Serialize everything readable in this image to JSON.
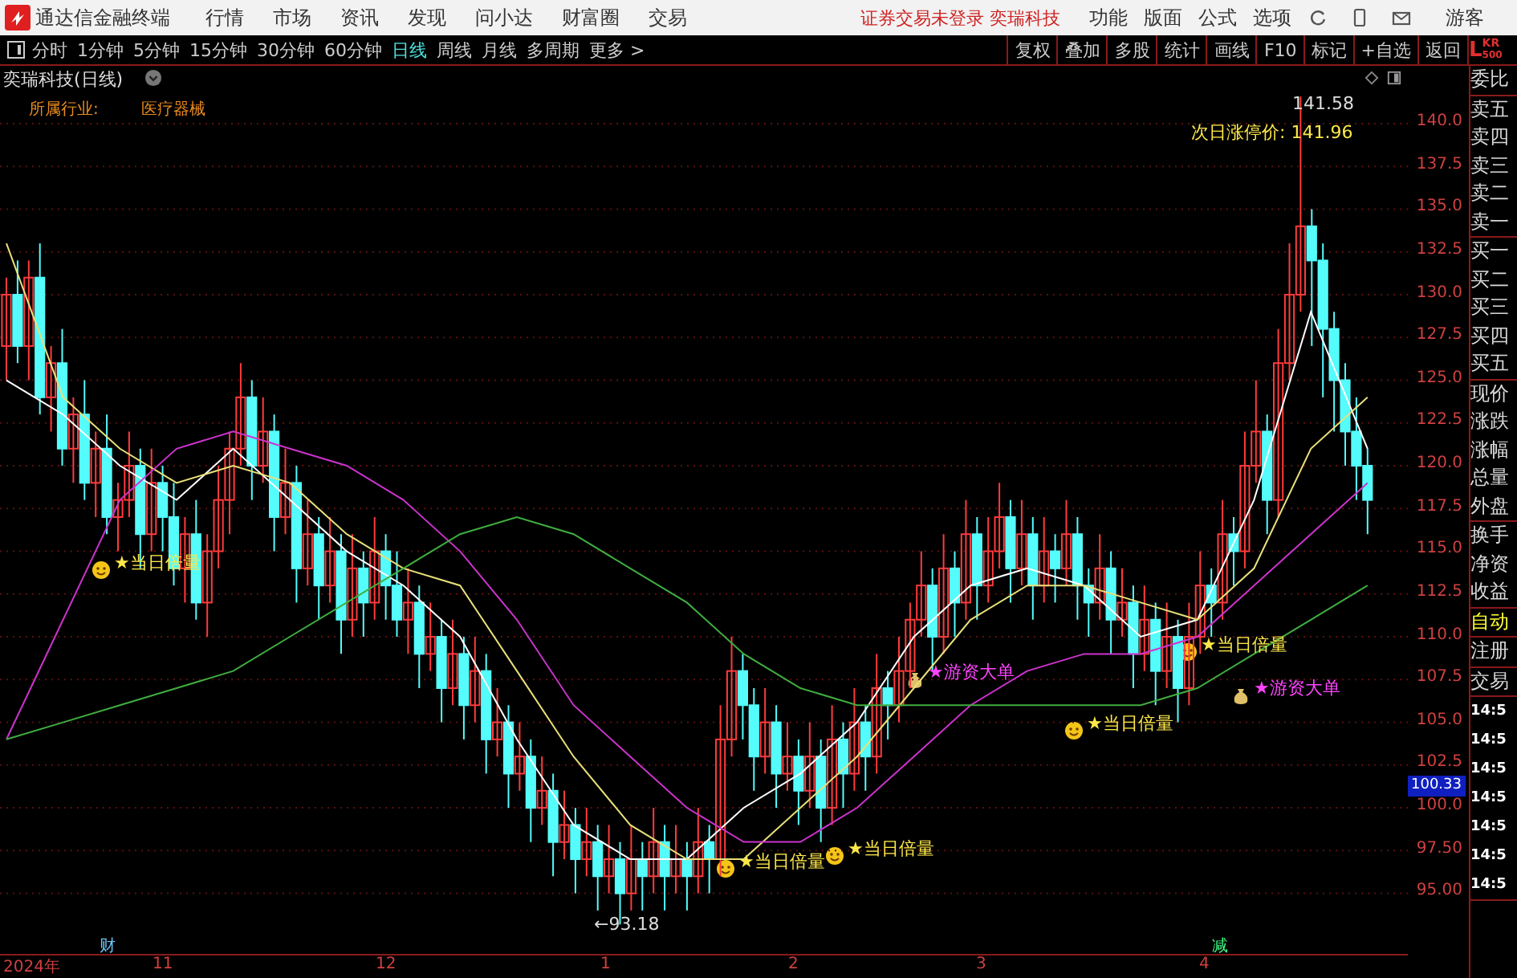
{
  "menu_bar": {
    "app_title": "通达信金融终端",
    "items": [
      "行情",
      "市场",
      "资讯",
      "发现",
      "问小达",
      "财富圈",
      "交易"
    ],
    "status": "证券交易未登录 奕瑞科技",
    "right_items": [
      "功能",
      "版面",
      "公式",
      "选项"
    ],
    "user": "游客"
  },
  "toolbar": {
    "periods": [
      {
        "label": "分时",
        "selected": false
      },
      {
        "label": "1分钟",
        "selected": false
      },
      {
        "label": "5分钟",
        "selected": false
      },
      {
        "label": "15分钟",
        "selected": false
      },
      {
        "label": "30分钟",
        "selected": false
      },
      {
        "label": "60分钟",
        "selected": false
      },
      {
        "label": "日线",
        "selected": true
      },
      {
        "label": "周线",
        "selected": false
      },
      {
        "label": "月线",
        "selected": false
      },
      {
        "label": "多周期",
        "selected": false
      },
      {
        "label": "更多 >",
        "selected": false
      }
    ],
    "buttons": [
      "复权",
      "叠加",
      "多股",
      "统计",
      "画线",
      "F10",
      "标记",
      "+自选",
      "返回"
    ]
  },
  "chart": {
    "title": "奕瑞科技(日线)",
    "industry_label": "所属行业:",
    "industry": "医疗器械",
    "annotations": [
      {
        "kind": "high",
        "text": "141.58"
      },
      {
        "kind": "limit",
        "text": "次日涨停价: 141.96"
      },
      {
        "kind": "signal",
        "text": "★当日倍量"
      },
      {
        "kind": "signal",
        "text": "★当日倍量"
      },
      {
        "kind": "signal",
        "text": "★当日倍量"
      },
      {
        "kind": "fund",
        "text": "★游资大单"
      },
      {
        "kind": "fund",
        "text": "★游资大单"
      },
      {
        "kind": "signal",
        "text": "★当日倍量"
      },
      {
        "kind": "signal",
        "text": "★当日倍量"
      },
      {
        "kind": "low",
        "text": "←93.18"
      },
      {
        "kind": "event",
        "text": "财"
      },
      {
        "kind": "event_down",
        "text": "减"
      }
    ],
    "chart_data": {
      "type": "candlestick",
      "ylim": [
        95,
        140
      ],
      "grid": true,
      "ohlc": [
        [
          127,
          131,
          125,
          130
        ],
        [
          130,
          132,
          126,
          127
        ],
        [
          127,
          132,
          125,
          131
        ],
        [
          131,
          133,
          123,
          124
        ],
        [
          124,
          127,
          122,
          126
        ],
        [
          126,
          128,
          120,
          121
        ],
        [
          121,
          124,
          119,
          123
        ],
        [
          123,
          125,
          118,
          119
        ],
        [
          119,
          122,
          117,
          121
        ],
        [
          121,
          123,
          116,
          117
        ],
        [
          117,
          119,
          115,
          118
        ],
        [
          118,
          122,
          117,
          120
        ],
        [
          120,
          121,
          114,
          116
        ],
        [
          116,
          121,
          115,
          119
        ],
        [
          119,
          120,
          115,
          117
        ],
        [
          117,
          119,
          113,
          114
        ],
        [
          114,
          117,
          112,
          116
        ],
        [
          116,
          118,
          111,
          112
        ],
        [
          112,
          116,
          110,
          115
        ],
        [
          115,
          120,
          114,
          118
        ],
        [
          118,
          122,
          116,
          121
        ],
        [
          121,
          126,
          120,
          124
        ],
        [
          124,
          125,
          118,
          120
        ],
        [
          120,
          124,
          119,
          122
        ],
        [
          122,
          123,
          115,
          117
        ],
        [
          117,
          121,
          116,
          119
        ],
        [
          119,
          120,
          112,
          114
        ],
        [
          114,
          118,
          113,
          116
        ],
        [
          116,
          117,
          111,
          113
        ],
        [
          113,
          117,
          112,
          115
        ],
        [
          115,
          116,
          109,
          111
        ],
        [
          111,
          116,
          110,
          114
        ],
        [
          114,
          115,
          110,
          112
        ],
        [
          112,
          117,
          111,
          115
        ],
        [
          115,
          116,
          111,
          113
        ],
        [
          113,
          115,
          110,
          111
        ],
        [
          111,
          114,
          109,
          112
        ],
        [
          112,
          113,
          107,
          109
        ],
        [
          109,
          112,
          108,
          110
        ],
        [
          110,
          111,
          105,
          107
        ],
        [
          107,
          111,
          106,
          109
        ],
        [
          109,
          110,
          104,
          106
        ],
        [
          106,
          110,
          105,
          108
        ],
        [
          108,
          109,
          102,
          104
        ],
        [
          104,
          107,
          103,
          105
        ],
        [
          105,
          106,
          100,
          102
        ],
        [
          102,
          105,
          101,
          103
        ],
        [
          103,
          104,
          98,
          100
        ],
        [
          100,
          103,
          99,
          101
        ],
        [
          101,
          102,
          96,
          98
        ],
        [
          98,
          101,
          97,
          99
        ],
        [
          99,
          100,
          95,
          97
        ],
        [
          97,
          100,
          96,
          98
        ],
        [
          98,
          99,
          94,
          96
        ],
        [
          96,
          99,
          95,
          97
        ],
        [
          97,
          98,
          93.18,
          95
        ],
        [
          95,
          99,
          94,
          97
        ],
        [
          97,
          98,
          94,
          96
        ],
        [
          96,
          100,
          95,
          98
        ],
        [
          98,
          99,
          94,
          96
        ],
        [
          96,
          99,
          95,
          97
        ],
        [
          97,
          98,
          94,
          96
        ],
        [
          96,
          100,
          95,
          98
        ],
        [
          98,
          99,
          95,
          97
        ],
        [
          97,
          106,
          96,
          104
        ],
        [
          104,
          110,
          103,
          108
        ],
        [
          108,
          109,
          104,
          106
        ],
        [
          106,
          107,
          101,
          103
        ],
        [
          103,
          107,
          102,
          105
        ],
        [
          105,
          106,
          100,
          102
        ],
        [
          102,
          105,
          101,
          103
        ],
        [
          103,
          104,
          99,
          101
        ],
        [
          101,
          105,
          100,
          103
        ],
        [
          103,
          104,
          98,
          100
        ],
        [
          100,
          106,
          99,
          104
        ],
        [
          104,
          105,
          100,
          102
        ],
        [
          102,
          107,
          101,
          105
        ],
        [
          105,
          106,
          101,
          103
        ],
        [
          103,
          109,
          102,
          107
        ],
        [
          107,
          108,
          104,
          106
        ],
        [
          106,
          110,
          105,
          108
        ],
        [
          108,
          112,
          107,
          111
        ],
        [
          111,
          115,
          110,
          113
        ],
        [
          113,
          114,
          108,
          110
        ],
        [
          110,
          116,
          109,
          114
        ],
        [
          114,
          115,
          110,
          112
        ],
        [
          112,
          118,
          111,
          116
        ],
        [
          116,
          117,
          111,
          113
        ],
        [
          113,
          117,
          112,
          115
        ],
        [
          115,
          119,
          114,
          117
        ],
        [
          117,
          118,
          112,
          114
        ],
        [
          114,
          118,
          113,
          116
        ],
        [
          116,
          117,
          111,
          113
        ],
        [
          113,
          117,
          112,
          115
        ],
        [
          115,
          116,
          112,
          114
        ],
        [
          114,
          118,
          113,
          116
        ],
        [
          116,
          117,
          111,
          113
        ],
        [
          113,
          114,
          110,
          112
        ],
        [
          112,
          116,
          111,
          114
        ],
        [
          114,
          115,
          109,
          111
        ],
        [
          111,
          114,
          110,
          112
        ],
        [
          112,
          113,
          107,
          109
        ],
        [
          109,
          113,
          108,
          111
        ],
        [
          111,
          112,
          106,
          108
        ],
        [
          108,
          112,
          107,
          110
        ],
        [
          110,
          111,
          105,
          107
        ],
        [
          107,
          112,
          106,
          110
        ],
        [
          110,
          115,
          109,
          113
        ],
        [
          113,
          114,
          110,
          112
        ],
        [
          112,
          118,
          111,
          116
        ],
        [
          116,
          117,
          113,
          115
        ],
        [
          115,
          122,
          114,
          120
        ],
        [
          120,
          125,
          119,
          122
        ],
        [
          122,
          123,
          116,
          118
        ],
        [
          118,
          128,
          117,
          126
        ],
        [
          126,
          133,
          125,
          130
        ],
        [
          130,
          141.58,
          129,
          134
        ],
        [
          134,
          135,
          127,
          132
        ],
        [
          132,
          133,
          124,
          128
        ],
        [
          128,
          129,
          122,
          125
        ],
        [
          125,
          126,
          120,
          122
        ],
        [
          122,
          124,
          118,
          120
        ],
        [
          120,
          121,
          116,
          118
        ]
      ],
      "yticks": [
        {
          "value": 140,
          "label": "140.0"
        },
        {
          "value": 137.5,
          "label": "137.5"
        },
        {
          "value": 135,
          "label": "135.0"
        },
        {
          "value": 132.5,
          "label": "132.5"
        },
        {
          "value": 130,
          "label": "130.0"
        },
        {
          "value": 127.5,
          "label": "127.5"
        },
        {
          "value": 125,
          "label": "125.0"
        },
        {
          "value": 122.5,
          "label": "122.5"
        },
        {
          "value": 120,
          "label": "120.0"
        },
        {
          "value": 117.5,
          "label": "117.5"
        },
        {
          "value": 115,
          "label": "115.0"
        },
        {
          "value": 112.5,
          "label": "112.5"
        },
        {
          "value": 110,
          "label": "110.0"
        },
        {
          "value": 107.5,
          "label": "107.5"
        },
        {
          "value": 105,
          "label": "105.0"
        },
        {
          "value": 102.5,
          "label": "102.5"
        },
        {
          "value": 100,
          "label": "100.0"
        },
        {
          "value": 97.5,
          "label": "97.50"
        },
        {
          "value": 95,
          "label": "95.00"
        }
      ]
    },
    "moving_averages": {
      "chart_data": {
        "type": "line",
        "ylim": [
          95,
          140
        ],
        "series": [
          {
            "color": "#ffffff",
            "values": [
              125,
              123,
              120,
              118,
              121,
              118,
              115,
              113,
              110,
              104,
              99,
              97,
              97,
              100,
              102,
              105,
              110,
              113,
              114,
              113,
              110,
              111,
              118,
              129,
              121
            ]
          },
          {
            "color": "#e8e07a",
            "values": [
              133,
              124,
              121,
              119,
              120,
              119,
              116,
              114,
              113,
              108,
              103,
              99,
              97,
              97,
              100,
              103,
              107,
              111,
              113,
              113,
              112,
              111,
              114,
              121,
              124
            ]
          },
          {
            "color": "#cc33cc",
            "values": [
              104,
              111,
              118,
              121,
              122,
              121,
              120,
              118,
              115,
              111,
              106,
              103,
              100,
              98,
              98,
              100,
              103,
              106,
              108,
              109,
              109,
              110,
              113,
              116,
              119
            ]
          },
          {
            "color": "#3fae3f",
            "values": [
              104,
              105,
              106,
              107,
              108,
              110,
              112,
              114,
              116,
              117,
              116,
              114,
              112,
              109,
              107,
              106,
              106,
              106,
              106,
              106,
              106,
              107,
              109,
              111,
              113
            ]
          }
        ]
      }
    },
    "price_tag": "100.33",
    "date_axis": [
      "2024年",
      "11",
      "12",
      "1",
      "2",
      "3",
      "4"
    ]
  },
  "quote_header": {
    "letter": "L",
    "code": "KR",
    "sub": "500"
  },
  "quote_panel": [
    {
      "kind": "label",
      "items": [
        "委比"
      ]
    },
    {
      "kind": "label",
      "items": [
        "卖五",
        "卖四",
        "卖三",
        "卖二",
        "卖一"
      ]
    },
    {
      "kind": "label",
      "items": [
        "买一",
        "买二",
        "买三",
        "买四",
        "买五"
      ]
    },
    {
      "kind": "label",
      "items": [
        "现价",
        "涨跌",
        "涨幅",
        "总量",
        "外盘"
      ]
    },
    {
      "kind": "label",
      "items": [
        "换手",
        "净资",
        "收益"
      ]
    },
    {
      "kind": "action",
      "items": [
        "自动"
      ]
    },
    {
      "kind": "label",
      "items": [
        "注册"
      ]
    },
    {
      "kind": "label",
      "items": [
        "交易"
      ]
    },
    {
      "kind": "time",
      "items": [
        "14:5",
        "14:5",
        "14:5",
        "14:5",
        "14:5",
        "14:5",
        "14:5"
      ]
    }
  ]
}
